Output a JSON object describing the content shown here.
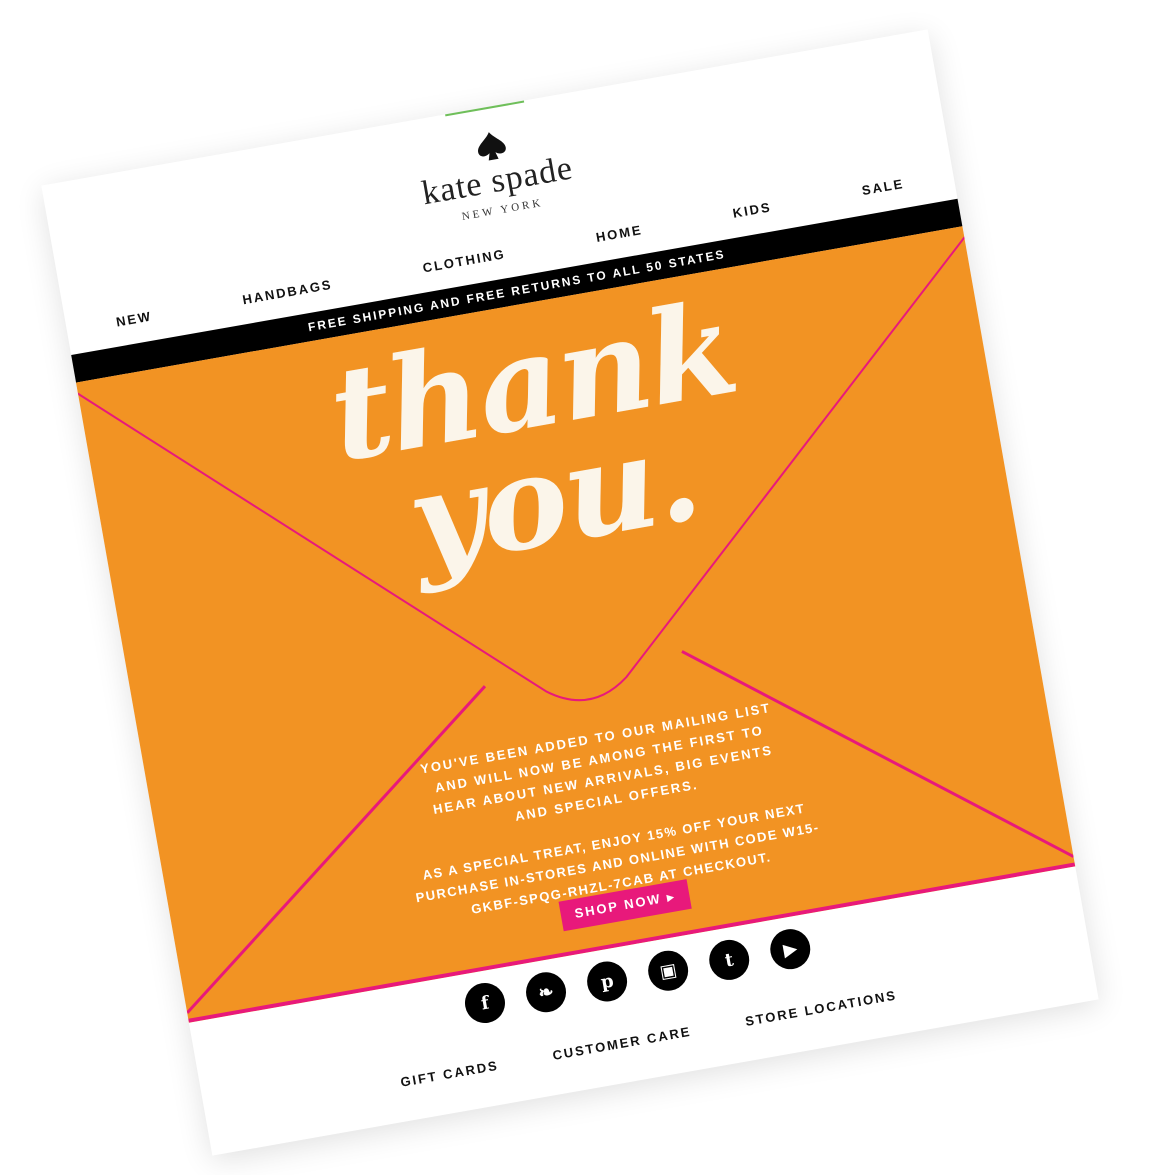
{
  "brand": {
    "name": "kate spade",
    "location": "NEW YORK"
  },
  "nav": [
    "NEW",
    "HANDBAGS",
    "CLOTHING",
    "HOME",
    "KIDS",
    "SALE"
  ],
  "shipping_banner": "FREE SHIPPING AND FREE RETURNS TO ALL 50 STATES",
  "hero": {
    "headline_line1": "thank",
    "headline_line2": "you."
  },
  "message": "YOU'VE BEEN ADDED TO OUR MAILING LIST AND WILL NOW BE AMONG THE FIRST TO HEAR ABOUT NEW ARRIVALS, BIG EVENTS AND SPECIAL OFFERS.",
  "promo": "AS A SPECIAL TREAT, ENJOY 15% OFF YOUR NEXT PURCHASE IN-STORES AND ONLINE WITH CODE W15-GKBF-SPQG-RHZL-7CAB AT CHECKOUT.",
  "cta": "SHOP NOW ▸",
  "social": [
    {
      "name": "facebook-icon",
      "glyph": "f"
    },
    {
      "name": "twitter-icon",
      "glyph": "❧"
    },
    {
      "name": "pinterest-icon",
      "glyph": "p"
    },
    {
      "name": "instagram-icon",
      "glyph": "▣"
    },
    {
      "name": "tumblr-icon",
      "glyph": "t"
    },
    {
      "name": "youtube-icon",
      "glyph": "▶"
    }
  ],
  "footer": [
    "GIFT CARDS",
    "CUSTOMER CARE",
    "STORE LOCATIONS"
  ],
  "colors": {
    "envelope": "#f29323",
    "envelope_edge": "#e8197b",
    "cta_bg": "#e8197b",
    "bar_bg": "#000000"
  }
}
